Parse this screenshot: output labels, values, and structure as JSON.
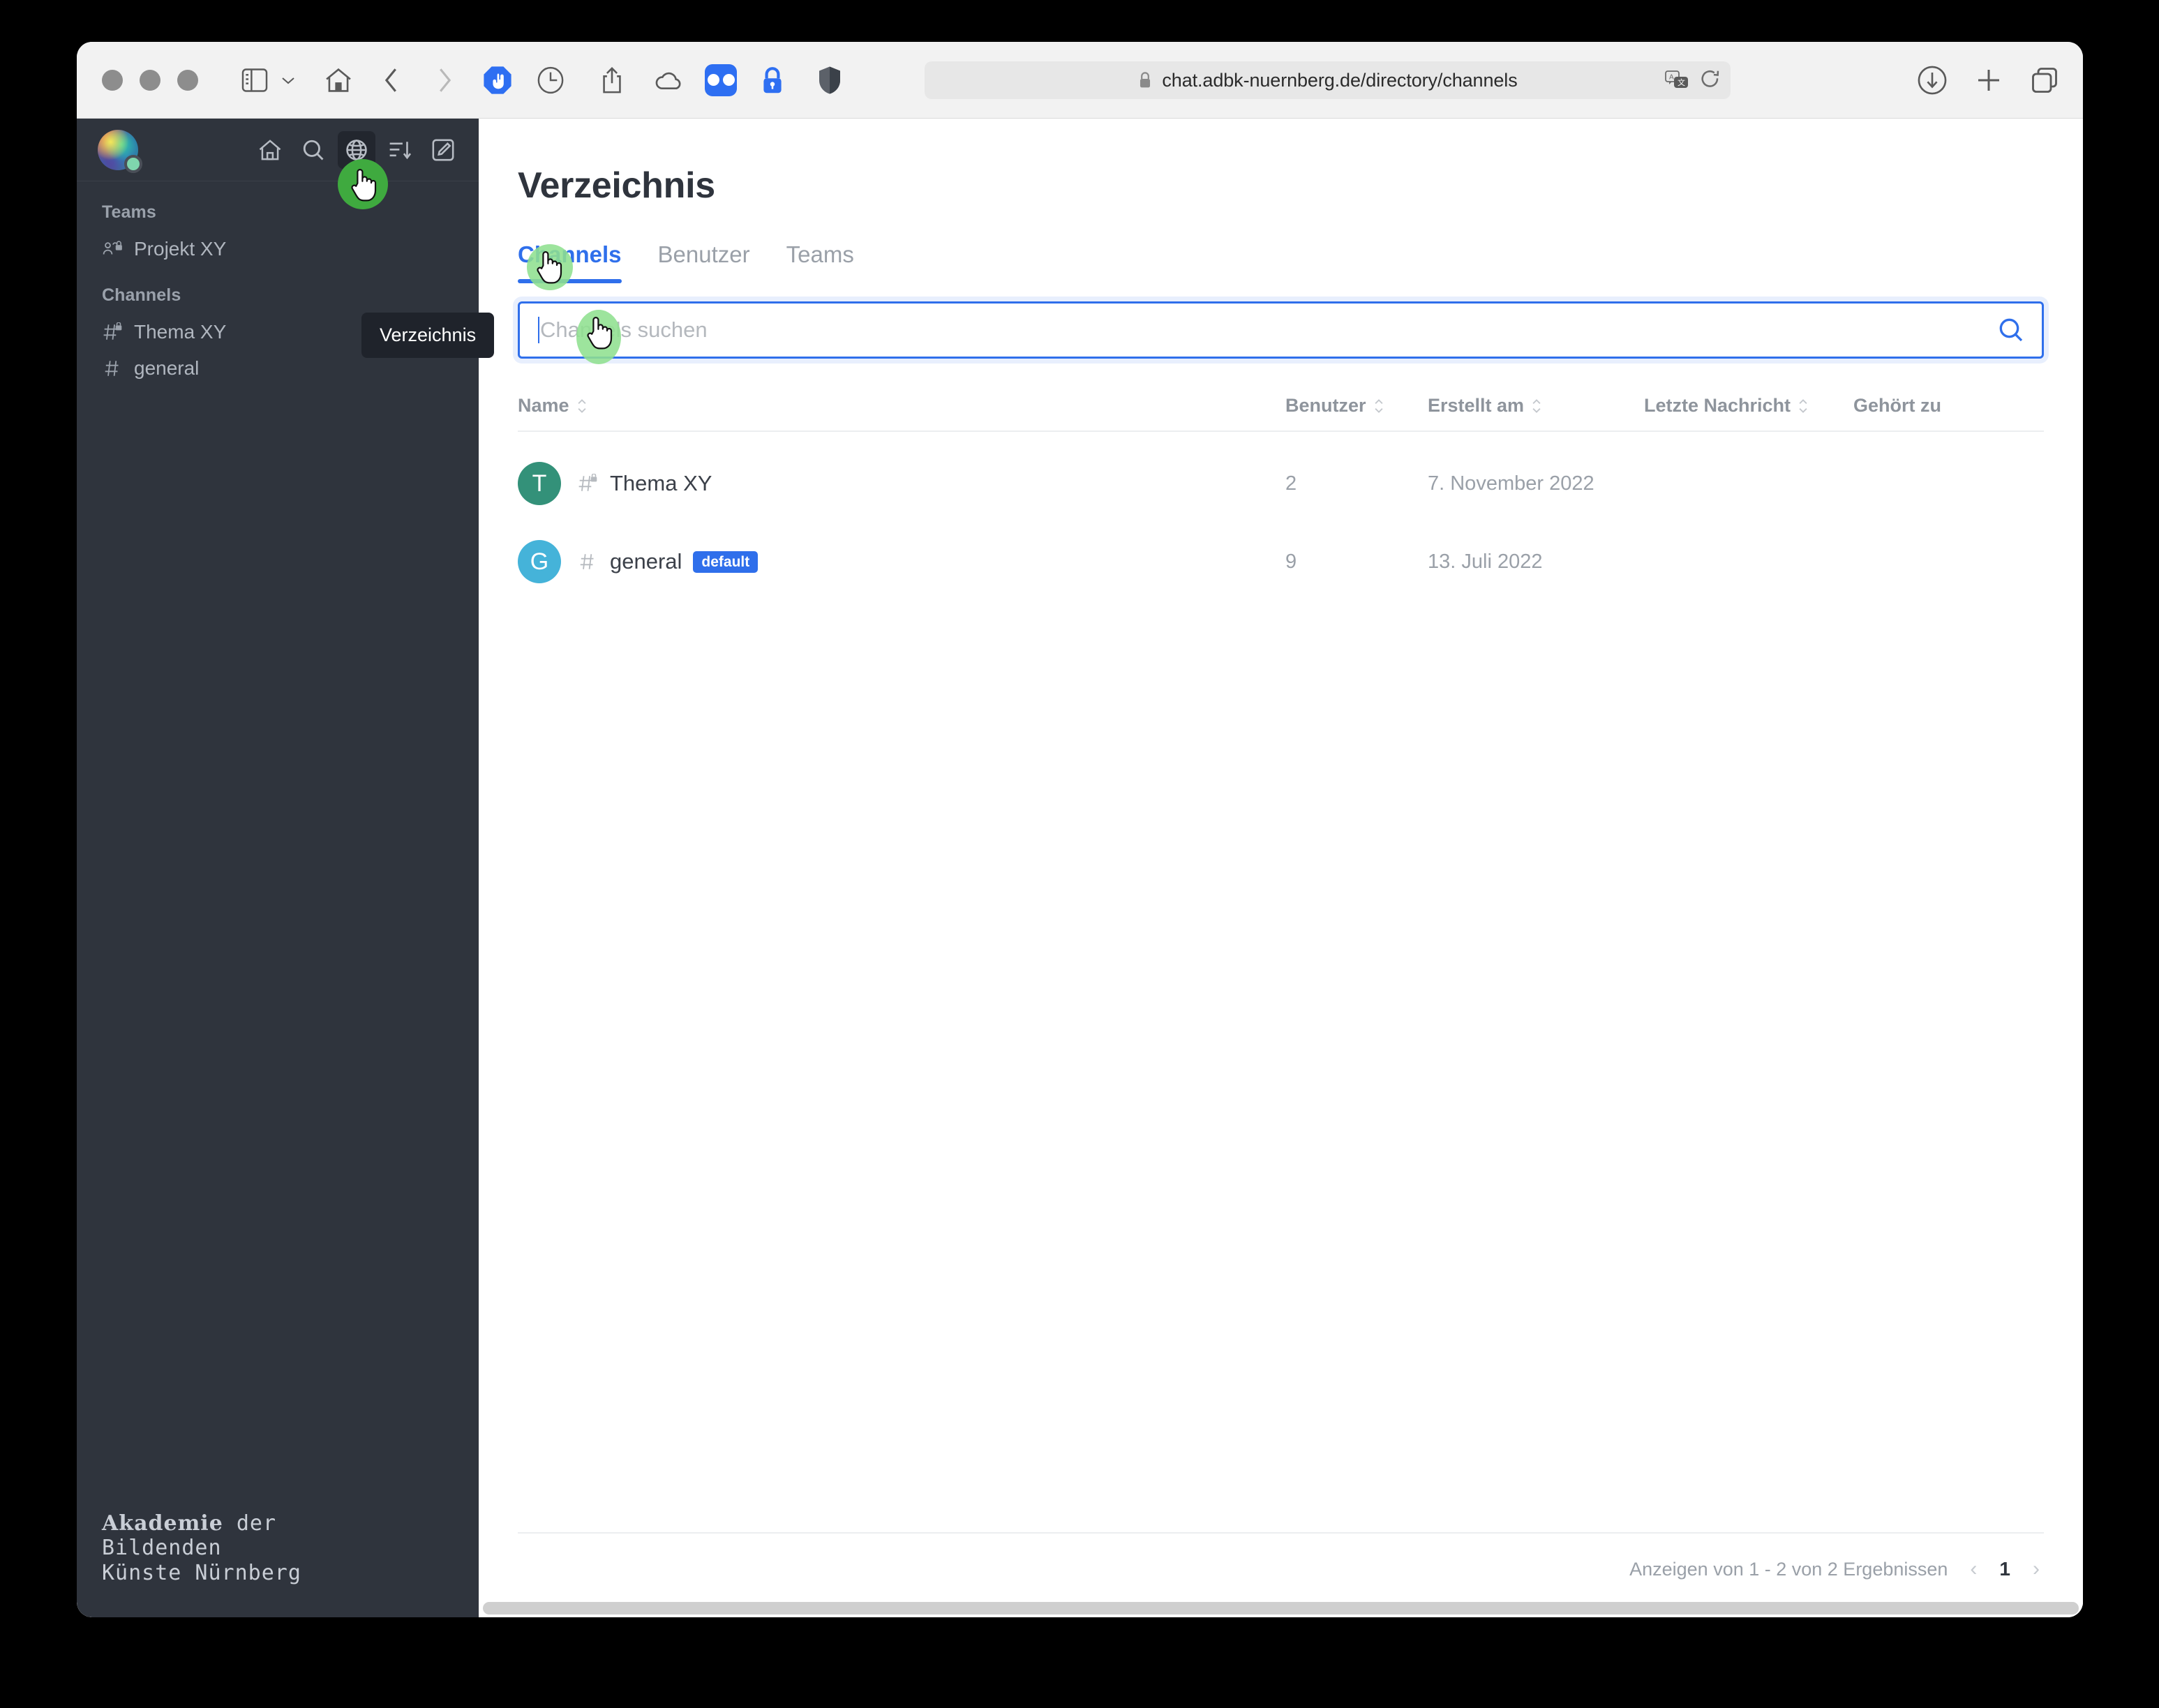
{
  "browser": {
    "url": "chat.adbk-nuernberg.de/directory/channels",
    "traffic_lights": [
      "close-button",
      "minimize-button",
      "zoom-button"
    ],
    "toolbar_icons": [
      "sidebar-toggle-icon",
      "chevron-down-icon",
      "home-icon",
      "back-icon",
      "forward-icon",
      "adblock-icon",
      "history-icon",
      "share-icon",
      "cloud-icon",
      "password-manager-icon",
      "lock-extension-icon",
      "shield-icon"
    ],
    "url_bar_icons": [
      "lock-icon",
      "translate-icon",
      "reload-icon"
    ],
    "right_icons": [
      "downloads-icon",
      "new-tab-icon",
      "tab-overview-icon"
    ]
  },
  "sidebar": {
    "avatar": "workspace-avatar",
    "status": "online",
    "actions": [
      {
        "name": "home-icon",
        "label": "Home"
      },
      {
        "name": "search-icon",
        "label": "Suchen"
      },
      {
        "name": "globe-icon",
        "label": "Verzeichnis",
        "active": true
      },
      {
        "name": "sort-icon",
        "label": "Sortieren"
      },
      {
        "name": "compose-icon",
        "label": "Neu erstellen"
      }
    ],
    "tooltip": "Verzeichnis",
    "sections": [
      {
        "title": "Teams",
        "items": [
          {
            "label": "Projekt XY",
            "icon": "team-private-icon"
          }
        ]
      },
      {
        "title": "Channels",
        "items": [
          {
            "label": "Thema XY",
            "icon": "hash-private-icon"
          },
          {
            "label": "general",
            "icon": "hash-icon"
          }
        ]
      }
    ],
    "logo": {
      "word_bold": "Akademie",
      "word_rest": " der",
      "line2": "Bildenden",
      "line3": "Künste Nürnberg"
    }
  },
  "main": {
    "title": "Verzeichnis",
    "tabs": [
      {
        "label": "Channels",
        "active": true
      },
      {
        "label": "Benutzer",
        "active": false
      },
      {
        "label": "Teams",
        "active": false
      }
    ],
    "search": {
      "placeholder": "Channels suchen",
      "value": "",
      "icon": "search-icon"
    },
    "table": {
      "headers": [
        {
          "label": "Name",
          "sortable": true
        },
        {
          "label": "Benutzer",
          "sortable": true
        },
        {
          "label": "Erstellt am",
          "sortable": true
        },
        {
          "label": "Letzte Nachricht",
          "sortable": true
        },
        {
          "label": "Gehört zu",
          "sortable": false
        }
      ],
      "rows": [
        {
          "avatar_letter": "T",
          "avatar_color": "#339179",
          "icon": "hash-private-icon",
          "name": "Thema XY",
          "badge": "",
          "users": "2",
          "created": "7. November 2022",
          "last_message": "",
          "belongs_to": ""
        },
        {
          "avatar_letter": "G",
          "avatar_color": "#45b3d9",
          "icon": "hash-icon",
          "name": "general",
          "badge": "default",
          "users": "9",
          "created": "13. Juli 2022",
          "last_message": "",
          "belongs_to": ""
        }
      ]
    },
    "pagination": {
      "results_text": "Anzeigen von 1 - 2 von 2 Ergebnissen",
      "prev": "‹",
      "page": "1",
      "next": "›"
    }
  },
  "colors": {
    "accent": "#2f6feb",
    "sidebar_bg": "#2f343d",
    "cursor_highlight": "#3faa3f"
  }
}
